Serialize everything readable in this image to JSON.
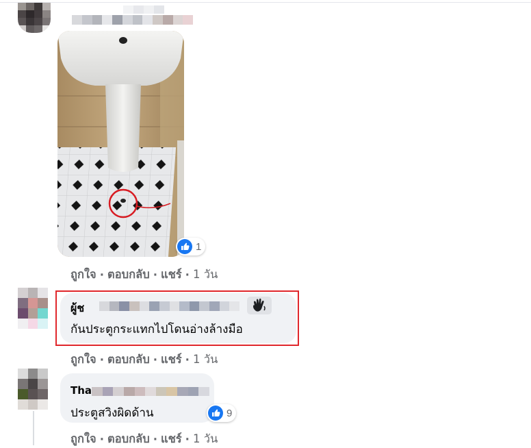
{
  "comment1": {
    "likes": "1",
    "actions": {
      "like": "ถูกใจ",
      "reply": "ตอบกลับ",
      "share": "แชร์",
      "time": "1 วัน"
    }
  },
  "comment2": {
    "author": "ผู้ช",
    "text": "กันประตูกระแทกไปโดนอ่างล้างมือ",
    "actions": {
      "like": "ถูกใจ",
      "reply": "ตอบกลับ",
      "share": "แชร์",
      "time": "1 วัน"
    }
  },
  "comment3": {
    "author": "Tha",
    "text": "ประตูสวิงผิดด้าน",
    "likes": "9",
    "actions": {
      "like": "ถูกใจ",
      "reply": "ตอบกลับ",
      "share": "แชร์",
      "time": "1 วัน"
    }
  },
  "icons": [
    "like-icon",
    "wave-hand-icon",
    "photo-sink-drain"
  ],
  "colors": {
    "like_blue": "#1877f2",
    "highlight": "#e0262b",
    "bubble": "#f0f2f5",
    "meta": "#65676b"
  }
}
